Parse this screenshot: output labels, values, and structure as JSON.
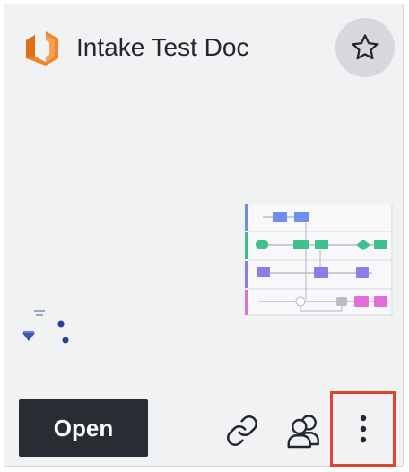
{
  "card": {
    "title": "Intake Test Doc",
    "open_label": "Open",
    "icons": {
      "logo": "lucid-logo-icon",
      "favorite": "star-icon",
      "copy_link": "link-icon",
      "share": "users-icon",
      "more": "more-vertical-icon"
    },
    "colors": {
      "logo": "#f2852a",
      "open_button": "#282c33",
      "highlight_border": "#e0452f",
      "card_background": "#f1f2f4"
    }
  }
}
